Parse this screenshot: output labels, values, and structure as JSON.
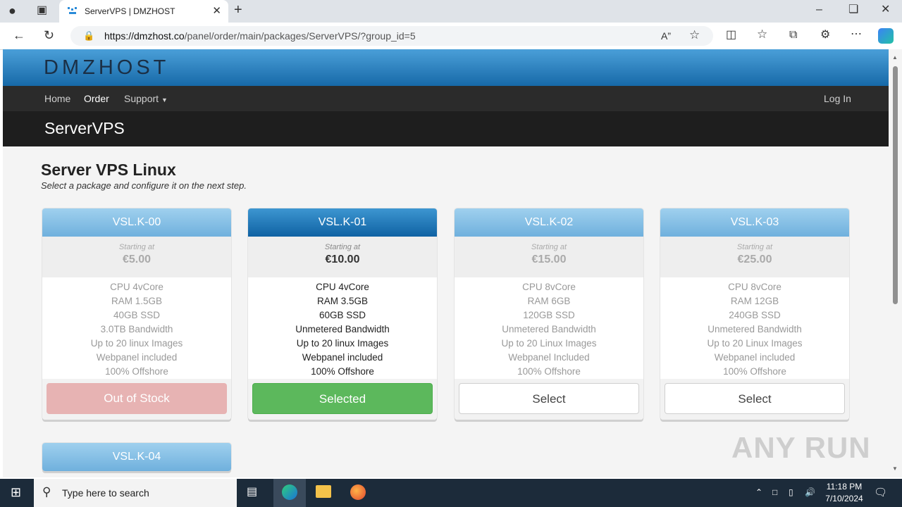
{
  "browser": {
    "tab_title": "ServerVPS | DMZHOST",
    "url_host": "https://dmzhost.co",
    "url_path": "/panel/order/main/packages/ServerVPS/?group_id=5"
  },
  "site": {
    "logo": "DMZHOST",
    "nav": {
      "home": "Home",
      "order": "Order",
      "support": "Support",
      "login": "Log In"
    },
    "page_title": "ServerVPS"
  },
  "main": {
    "heading": "Server VPS Linux",
    "subheading": "Select a package and configure it on the next step.",
    "price_label": "Starting at",
    "packages": [
      {
        "name": "VSL.K-00",
        "price": "€5.00",
        "features": [
          "CPU 4vCore",
          "RAM 1.5GB",
          "40GB SSD",
          "3.0TB Bandwidth",
          "Up to 20 linux Images",
          "Webpanel included",
          "100% Offshore"
        ],
        "button": "Out of Stock"
      },
      {
        "name": "VSL.K-01",
        "price": "€10.00",
        "features": [
          "CPU 4vCore",
          "RAM 3.5GB",
          "60GB SSD",
          "Unmetered Bandwidth",
          "Up to 20 linux Images",
          "Webpanel included",
          "100% Offshore"
        ],
        "button": "Selected"
      },
      {
        "name": "VSL.K-02",
        "price": "€15.00",
        "features": [
          "CPU 8vCore",
          "RAM 6GB",
          "120GB SSD",
          "Unmetered Bandwidth",
          "Up to 20 Linux Images",
          "Webpanel Included",
          "100% Offshore"
        ],
        "button": "Select"
      },
      {
        "name": "VSL.K-03",
        "price": "€25.00",
        "features": [
          "CPU 8vCore",
          "RAM 12GB",
          "240GB SSD",
          "Unmetered Bandwidth",
          "Up to 20 Linux Images",
          "Webpanel included",
          "100% Offshore"
        ],
        "button": "Select"
      },
      {
        "name": "VSL.K-04"
      }
    ]
  },
  "watermark": "ANY RUN",
  "taskbar": {
    "search_placeholder": "Type here to search",
    "time": "11:18 PM",
    "date": "7/10/2024"
  }
}
